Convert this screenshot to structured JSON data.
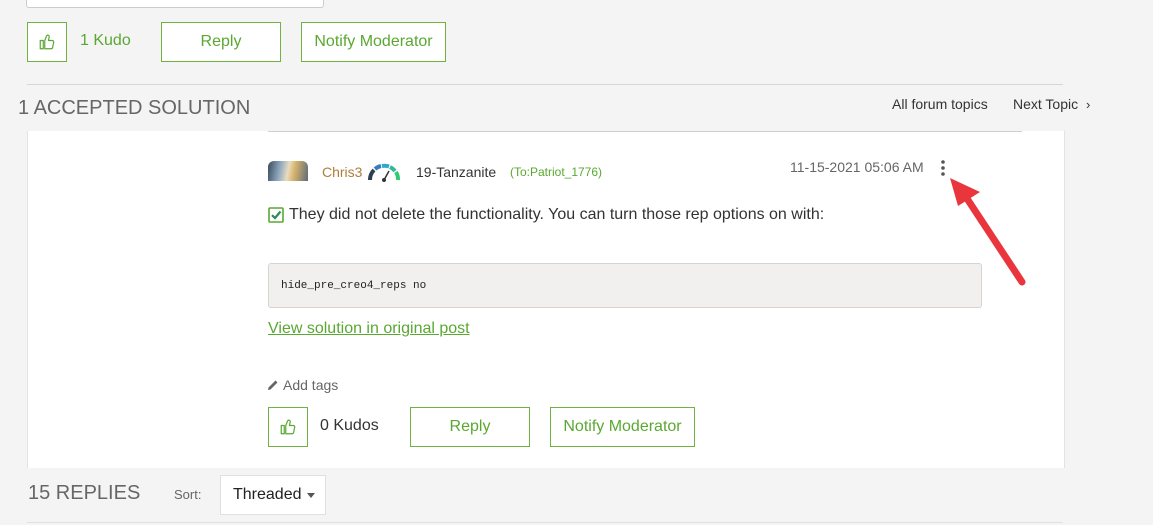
{
  "top_actions": {
    "kudo_count": "1 Kudo",
    "reply": "Reply",
    "notify": "Notify Moderator"
  },
  "solutions_header": {
    "title": "1 ACCEPTED SOLUTION",
    "all_topics": "All forum topics",
    "next_topic": "Next Topic"
  },
  "post": {
    "author": "Chris3",
    "rank": "19-Tanzanite",
    "recipient": "(To:Patriot_1776)",
    "timestamp": "11-15-2021 05:06 AM",
    "body": "They did not delete the functionality. You can turn those rep options on with:",
    "code": "hide_pre_creo4_reps no",
    "view_solution": "View solution in original post",
    "add_tags": "Add tags",
    "kudos": "0 Kudos",
    "reply": "Reply",
    "notify": "Notify Moderator"
  },
  "replies": {
    "count": "15 REPLIES",
    "sort_label": "Sort:",
    "sort_value": "Threaded"
  },
  "colors": {
    "accent": "#5aa832",
    "author": "#b07d3c",
    "annotation_arrow": "#e8363c"
  }
}
